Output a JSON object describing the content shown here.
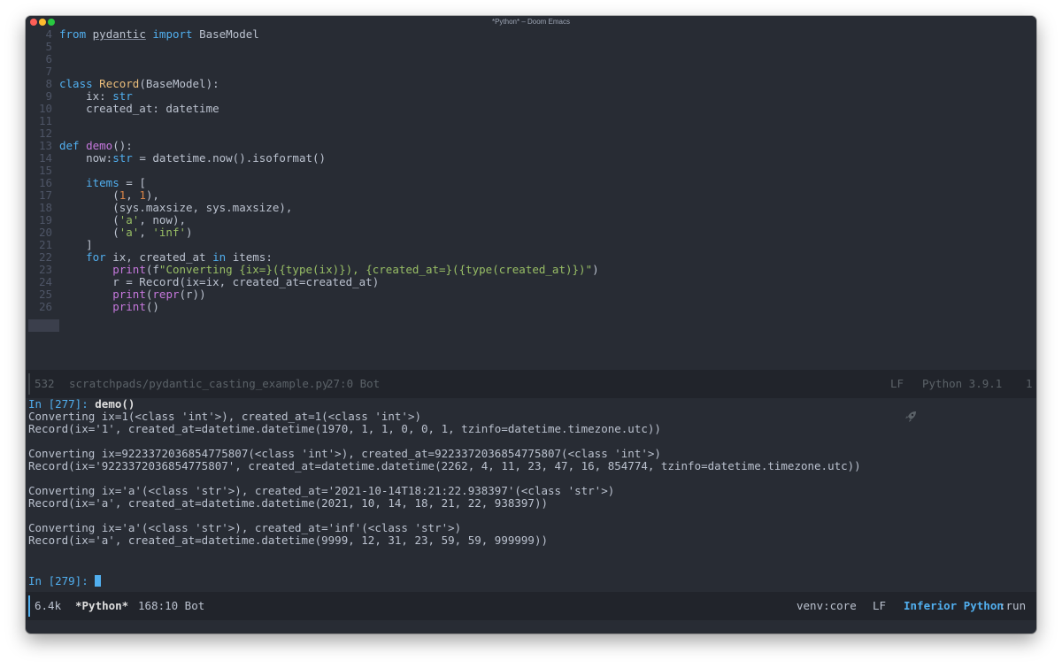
{
  "window": {
    "title": "*Python* – Doom Emacs"
  },
  "editor": {
    "lines": [
      {
        "n": "4",
        "t": [
          [
            "from",
            "kw"
          ],
          [
            " "
          ],
          [
            "pydantic",
            "ul"
          ],
          [
            " "
          ],
          [
            "import",
            "kw"
          ],
          [
            " BaseModel"
          ]
        ]
      },
      {
        "n": "5",
        "t": []
      },
      {
        "n": "6",
        "t": []
      },
      {
        "n": "7",
        "t": []
      },
      {
        "n": "8",
        "t": [
          [
            "class",
            "kw"
          ],
          [
            " "
          ],
          [
            "Record",
            "cl"
          ],
          [
            "(BaseModel):"
          ]
        ]
      },
      {
        "n": "9",
        "t": [
          [
            "    ix: "
          ],
          [
            "str",
            "kw"
          ]
        ]
      },
      {
        "n": "10",
        "t": [
          [
            "    created_at: datetime"
          ]
        ]
      },
      {
        "n": "11",
        "t": []
      },
      {
        "n": "12",
        "t": []
      },
      {
        "n": "13",
        "t": [
          [
            "def",
            "kw"
          ],
          [
            " "
          ],
          [
            "demo",
            "fn"
          ],
          [
            "():"
          ]
        ]
      },
      {
        "n": "14",
        "t": [
          [
            "    now:"
          ],
          [
            "str",
            "kw"
          ],
          [
            " = datetime.now().isoformat()"
          ]
        ]
      },
      {
        "n": "15",
        "t": []
      },
      {
        "n": "16",
        "t": [
          [
            "    "
          ],
          [
            "items",
            "kw"
          ],
          [
            " = ["
          ]
        ]
      },
      {
        "n": "17",
        "t": [
          [
            "        ("
          ],
          [
            "1",
            "nm"
          ],
          [
            ", "
          ],
          [
            "1",
            "nm"
          ],
          [
            "),"
          ]
        ]
      },
      {
        "n": "18",
        "t": [
          [
            "        (sys.maxsize, sys.maxsize),"
          ]
        ]
      },
      {
        "n": "19",
        "t": [
          [
            "        ("
          ],
          [
            "'a'",
            "st"
          ],
          [
            ", now),"
          ]
        ]
      },
      {
        "n": "20",
        "t": [
          [
            "        ("
          ],
          [
            "'a'",
            "st"
          ],
          [
            ", "
          ],
          [
            "'inf'",
            "st"
          ],
          [
            ")"
          ]
        ]
      },
      {
        "n": "21",
        "t": [
          [
            "    ]"
          ]
        ]
      },
      {
        "n": "22",
        "t": [
          [
            "    "
          ],
          [
            "for",
            "kw"
          ],
          [
            " ix, created_at "
          ],
          [
            "in",
            "kw"
          ],
          [
            " items:"
          ]
        ]
      },
      {
        "n": "23",
        "t": [
          [
            "        "
          ],
          [
            "print",
            "bi"
          ],
          [
            "(f"
          ],
          [
            "\"Converting {ix=}({type(ix)}), {created_at=}({type(created_at)})\"",
            "st"
          ],
          [
            ")"
          ]
        ]
      },
      {
        "n": "24",
        "t": [
          [
            "        r = Record(ix=ix, created_at=created_at)"
          ]
        ]
      },
      {
        "n": "25",
        "t": [
          [
            "        "
          ],
          [
            "print",
            "bi"
          ],
          [
            "("
          ],
          [
            "repr",
            "bi"
          ],
          [
            "(r))"
          ]
        ]
      },
      {
        "n": "26",
        "t": [
          [
            "        "
          ],
          [
            "print",
            "bi"
          ],
          [
            "()"
          ]
        ]
      }
    ]
  },
  "modeline_top": {
    "size": "532",
    "file": "scratchpads/pydantic_casting_example.py",
    "position": "27:0 Bot",
    "rocket_icon": "rocket-icon",
    "eol": "LF",
    "mode": "Python 3.9.1",
    "checker_icon": "no-entry-icon",
    "checker": "1"
  },
  "repl": {
    "prompt1": "In [277]: ",
    "command": "demo()",
    "output": [
      "Converting ix=1(<class 'int'>), created_at=1(<class 'int'>)",
      "Record(ix='1', created_at=datetime.datetime(1970, 1, 1, 0, 0, 1, tzinfo=datetime.timezone.utc))",
      "",
      "Converting ix=9223372036854775807(<class 'int'>), created_at=9223372036854775807(<class 'int'>)",
      "Record(ix='9223372036854775807', created_at=datetime.datetime(2262, 4, 11, 23, 47, 16, 854774, tzinfo=datetime.timezone.utc))",
      "",
      "Converting ix='a'(<class 'str'>), created_at='2021-10-14T18:21:22.938397'(<class 'str'>)",
      "Record(ix='a', created_at=datetime.datetime(2021, 10, 14, 18, 21, 22, 938397))",
      "",
      "Converting ix='a'(<class 'str'>), created_at='inf'(<class 'str'>)",
      "Record(ix='a', created_at=datetime.datetime(9999, 12, 31, 23, 59, 59, 999999))"
    ],
    "prompt2": "In [279]: "
  },
  "modeline_bottom": {
    "size": "6.4k",
    "buffer": "*Python*",
    "position": "168:10 Bot",
    "env": "venv:core",
    "eol": "LF",
    "mode": "Inferior Python",
    "state": ":run"
  },
  "colors": {
    "background": "#282c34",
    "keyword": "#51afef",
    "string": "#98be65",
    "type": "#ecbe7b",
    "function": "#c678dd",
    "number": "#da8548"
  }
}
